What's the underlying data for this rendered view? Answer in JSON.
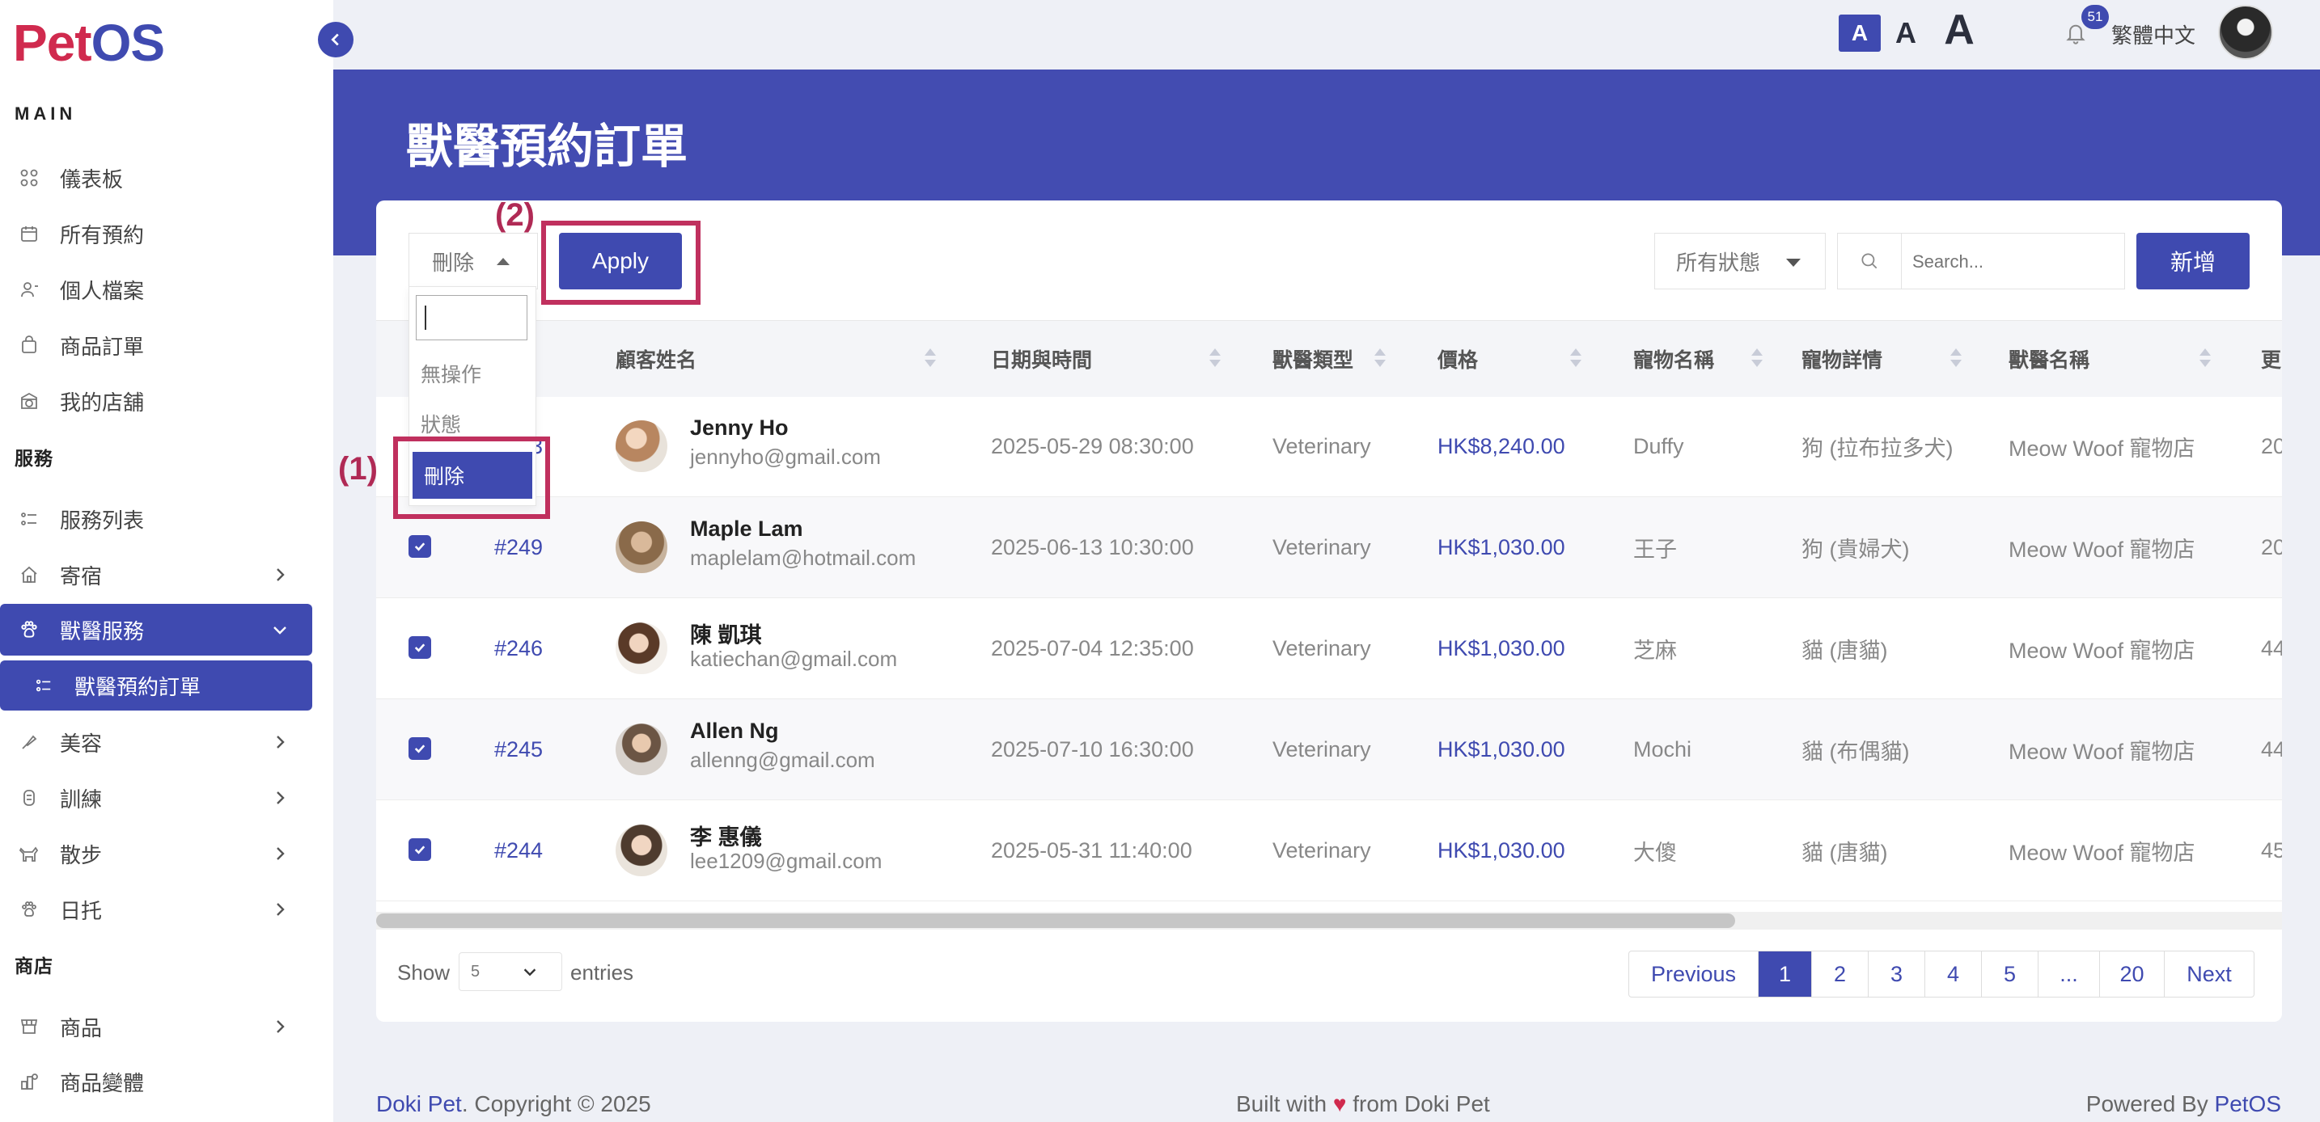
{
  "app": {
    "logo_pet": "Pet",
    "logo_os": "OS"
  },
  "sidebar": {
    "sections": {
      "main": "MAIN",
      "services": "服務",
      "shop": "商店"
    },
    "items": [
      {
        "label": "儀表板",
        "icon": "grid-icon"
      },
      {
        "label": "所有預約",
        "icon": "calendar-icon"
      },
      {
        "label": "個人檔案",
        "icon": "user-icon"
      },
      {
        "label": "商品訂單",
        "icon": "bag-icon"
      },
      {
        "label": "我的店舖",
        "icon": "store-icon"
      },
      {
        "label": "服務列表",
        "icon": "list-icon"
      },
      {
        "label": "寄宿",
        "icon": "house-icon"
      },
      {
        "label": "獸醫服務",
        "icon": "paw-icon"
      },
      {
        "label": "獸醫預約訂單",
        "icon": "list-icon"
      },
      {
        "label": "美容",
        "icon": "brush-icon"
      },
      {
        "label": "訓練",
        "icon": "bone-icon"
      },
      {
        "label": "散步",
        "icon": "dog-icon"
      },
      {
        "label": "日托",
        "icon": "paw-icon"
      },
      {
        "label": "商品",
        "icon": "shop-icon"
      },
      {
        "label": "商品變體",
        "icon": "variants-icon"
      }
    ]
  },
  "topbar": {
    "font_sizes": [
      "A",
      "A",
      "A"
    ],
    "notification_count": "51",
    "language": "繁體中文"
  },
  "page": {
    "title": "獸醫預約訂單"
  },
  "toolbar": {
    "bulk_action_value": "刪除",
    "apply_label": "Apply",
    "status_filter": "所有狀態",
    "search_placeholder": "Search...",
    "new_label": "新增"
  },
  "bulk_dropdown": {
    "options": [
      "無操作",
      "狀態",
      "刪除"
    ],
    "selected": "刪除"
  },
  "table": {
    "columns": [
      "顧客姓名",
      "日期與時間",
      "獸醫類型",
      "價格",
      "寵物名稱",
      "寵物詳情",
      "獸醫名稱",
      "更"
    ],
    "rows": [
      {
        "id": "#253",
        "name": "Jenny Ho",
        "email": "jennyho@gmail.com",
        "datetime": "2025-05-29 08:30:00",
        "vet_type": "Veterinary",
        "price": "HK$8,240.00",
        "pet_name": "Duffy",
        "pet_detail": "狗 (拉布拉多犬)",
        "vet_name": "Meow Woof 寵物店",
        "extra": "20",
        "checked": false
      },
      {
        "id": "#249",
        "name": "Maple Lam",
        "email": "maplelam@hotmail.com",
        "datetime": "2025-06-13 10:30:00",
        "vet_type": "Veterinary",
        "price": "HK$1,030.00",
        "pet_name": "王子",
        "pet_detail": "狗 (貴婦犬)",
        "vet_name": "Meow Woof 寵物店",
        "extra": "20",
        "checked": true
      },
      {
        "id": "#246",
        "name": "陳 凱琪",
        "email": "katiechan@gmail.com",
        "datetime": "2025-07-04 12:35:00",
        "vet_type": "Veterinary",
        "price": "HK$1,030.00",
        "pet_name": "芝麻",
        "pet_detail": "貓 (唐貓)",
        "vet_name": "Meow Woof 寵物店",
        "extra": "44",
        "checked": true
      },
      {
        "id": "#245",
        "name": "Allen Ng",
        "email": "allenng@gmail.com",
        "datetime": "2025-07-10 16:30:00",
        "vet_type": "Veterinary",
        "price": "HK$1,030.00",
        "pet_name": "Mochi",
        "pet_detail": "貓 (布偶貓)",
        "vet_name": "Meow Woof 寵物店",
        "extra": "44",
        "checked": true
      },
      {
        "id": "#244",
        "name": "李 惠儀",
        "email": "lee1209@gmail.com",
        "datetime": "2025-05-31 11:40:00",
        "vet_type": "Veterinary",
        "price": "HK$1,030.00",
        "pet_name": "大傻",
        "pet_detail": "貓 (唐貓)",
        "vet_name": "Meow Woof 寵物店",
        "extra": "45",
        "checked": true
      }
    ]
  },
  "pagination": {
    "show_label": "Show",
    "entries_value": "5",
    "entries_label": "entries",
    "previous": "Previous",
    "pages": [
      "1",
      "2",
      "3",
      "4",
      "5",
      "...",
      "20"
    ],
    "next": "Next",
    "current": "1"
  },
  "annotations": {
    "step1": "(1)",
    "step2": "(2)"
  },
  "footer": {
    "brand": "Doki Pet",
    "copyright": ". Copyright © 2025",
    "built_prefix": "Built with",
    "heart": "♥",
    "built_suffix": "from Doki Pet",
    "powered_prefix": "Powered By",
    "powered_brand": "PetOS"
  },
  "colors": {
    "accent": "#3f4ab0",
    "header_band": "#434cb1",
    "logo_red": "#d02a4e",
    "annotation": "#c0305e"
  }
}
